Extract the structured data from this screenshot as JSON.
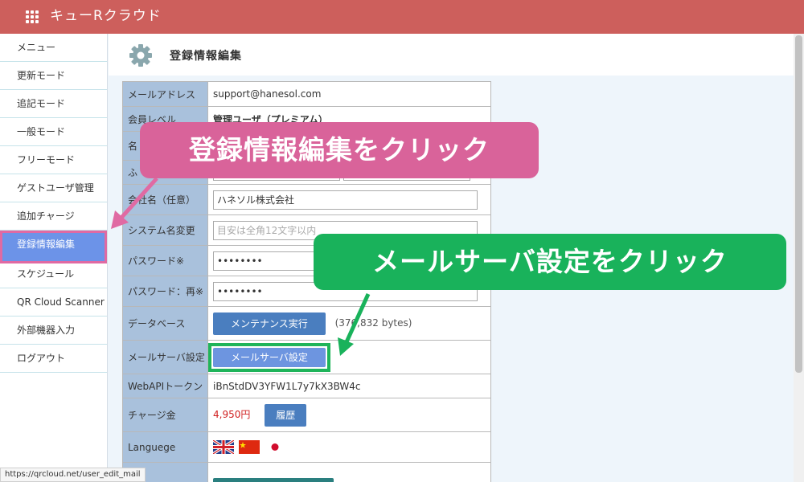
{
  "app": {
    "title": "キューRクラウド",
    "menu_icon": "grid-icon"
  },
  "sidebar": {
    "items": [
      {
        "label": "メニュー"
      },
      {
        "label": "更新モード"
      },
      {
        "label": "追記モード"
      },
      {
        "label": "一般モード"
      },
      {
        "label": "フリーモード"
      },
      {
        "label": "ゲストユーザ管理"
      },
      {
        "label": "追加チャージ"
      },
      {
        "label": "登録情報編集",
        "active": true
      },
      {
        "label": "スケジュール"
      },
      {
        "label": "QR Cloud Scanner"
      },
      {
        "label": "外部機器入力"
      },
      {
        "label": "ログアウト"
      }
    ]
  },
  "page": {
    "title": "登録情報編集",
    "icon": "gear-icon"
  },
  "form": {
    "email": {
      "label": "メールアドレス",
      "value": "support@hanesol.com"
    },
    "level": {
      "label": "会員レベル",
      "value": "管理ユーザ（プレミアム）"
    },
    "name": {
      "label": "名"
    },
    "kana": {
      "label": "ふ"
    },
    "company": {
      "label": "会社名（任意）",
      "value": "ハネソル株式会社"
    },
    "system_name": {
      "label": "システム名変更",
      "placeholder": "目安は全角12文字以内"
    },
    "password": {
      "label": "パスワード※",
      "value": "••••••••"
    },
    "password_confirm": {
      "label": "パスワード：再※",
      "value": "••••••••"
    },
    "database": {
      "label": "データベース",
      "button": "メンテナンス実行",
      "size": "(376,832 bytes)"
    },
    "mail_server": {
      "label": "メールサーバ設定",
      "button": "メールサーバ設定"
    },
    "webapi": {
      "label": "WebAPIトークン",
      "value": "iBnStdDV3YFW1L7y7kX3BW4c"
    },
    "charge": {
      "label": "チャージ金",
      "value": "4,950円",
      "button": "履歴"
    },
    "language": {
      "label": "Languege",
      "flags": [
        "uk-flag-icon",
        "china-flag-icon",
        "japan-flag-icon"
      ]
    }
  },
  "callouts": {
    "pink": "登録情報編集をクリック",
    "green": "メールサーバ設定をクリック"
  },
  "status_url": "https://qrcloud.net/user_edit_mail",
  "colors": {
    "header": "#cd5f5c",
    "active": "#6c93e8",
    "pink": "#d9639a",
    "green": "#19b25b",
    "label_bg": "#a9c1dc"
  }
}
